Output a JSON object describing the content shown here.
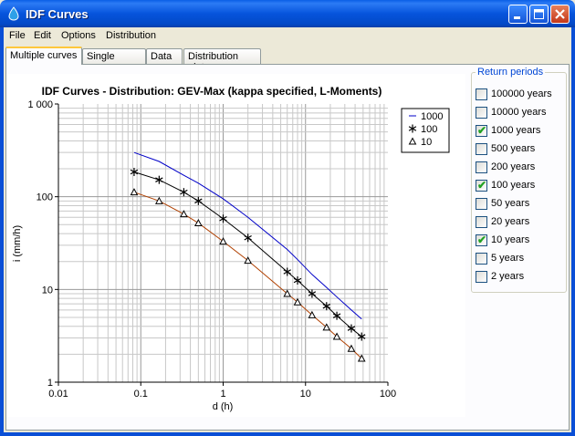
{
  "window": {
    "title": "IDF Curves"
  },
  "menu": [
    {
      "label": "File"
    },
    {
      "label": "Edit"
    },
    {
      "label": "Options"
    },
    {
      "label": "Distribution"
    }
  ],
  "tabs": [
    {
      "label": "Multiple curves",
      "active": true
    },
    {
      "label": "Single curve"
    },
    {
      "label": "Data"
    },
    {
      "label": "Distribution plot"
    }
  ],
  "return_periods": {
    "title": "Return periods",
    "items": [
      {
        "label": "100000 years",
        "checked": false
      },
      {
        "label": "10000 years",
        "checked": false
      },
      {
        "label": "1000 years",
        "checked": true
      },
      {
        "label": "500 years",
        "checked": false
      },
      {
        "label": "200 years",
        "checked": false
      },
      {
        "label": "100 years",
        "checked": true
      },
      {
        "label": "50 years",
        "checked": false
      },
      {
        "label": "20 years",
        "checked": false
      },
      {
        "label": "10 years",
        "checked": true
      },
      {
        "label": "5 years",
        "checked": false
      },
      {
        "label": "2 years",
        "checked": false
      }
    ]
  },
  "colors": {
    "accent_title": "#0046d5",
    "check": "#21a121",
    "series_1000": "#0000c8",
    "series_100": "#000000",
    "series_10": "#b04000"
  },
  "chart_data": {
    "type": "line",
    "title": "IDF Curves - Distribution: GEV-Max (kappa specified, L-Moments)",
    "xlabel": "d (h)",
    "ylabel": "i (mm/h)",
    "xscale": "log",
    "yscale": "log",
    "xlim": [
      0.01,
      100
    ],
    "ylim": [
      1,
      1000
    ],
    "grid": true,
    "legend_position": "top-right",
    "x_ticks": [
      "0.01",
      "0.1",
      "1",
      "10",
      "100"
    ],
    "y_ticks": [
      "1",
      "10",
      "100",
      "1 000"
    ],
    "series": [
      {
        "name": "1000",
        "marker": "line",
        "color": "#0000c8",
        "x": [
          0.083,
          0.167,
          0.333,
          0.5,
          1,
          2,
          6,
          8,
          12,
          18,
          24,
          36,
          48
        ],
        "y": [
          300,
          240,
          170,
          140,
          95,
          60,
          27,
          21,
          14.5,
          10.5,
          8.3,
          6.0,
          4.8
        ]
      },
      {
        "name": "100",
        "marker": "asterisk",
        "color": "#000000",
        "x": [
          0.083,
          0.167,
          0.333,
          0.5,
          1,
          2,
          6,
          8,
          12,
          18,
          24,
          36,
          48
        ],
        "y": [
          185,
          152,
          112,
          90,
          58,
          36,
          15.5,
          12.5,
          9.0,
          6.6,
          5.2,
          3.8,
          3.1
        ]
      },
      {
        "name": "10",
        "marker": "triangle",
        "color": "#b04000",
        "x": [
          0.083,
          0.167,
          0.333,
          0.5,
          1,
          2,
          6,
          8,
          12,
          18,
          24,
          36,
          48
        ],
        "y": [
          112,
          90,
          65,
          52,
          33,
          20.5,
          9.0,
          7.3,
          5.3,
          3.9,
          3.1,
          2.3,
          1.8
        ]
      }
    ]
  }
}
